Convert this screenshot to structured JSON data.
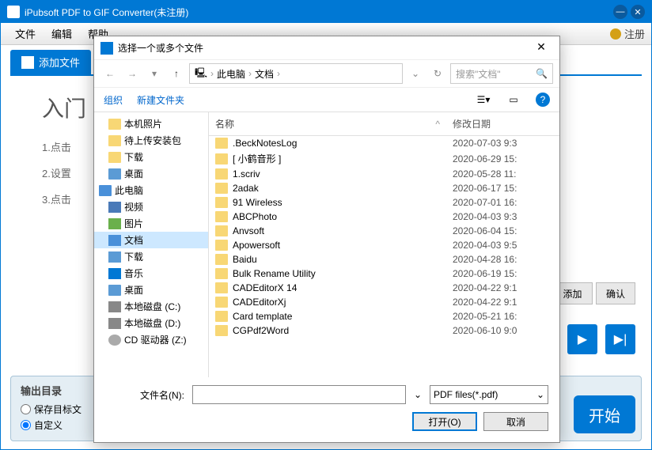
{
  "app": {
    "title": "iPubsoft PDF to GIF Converter(未注册)",
    "menus": {
      "file": "文件",
      "edit": "编辑",
      "help": "帮助",
      "register": "注册"
    },
    "add_file": "添加文件",
    "heading": "入门",
    "steps": {
      "s1": "1.点击",
      "s2": "2.设置",
      "s3": "3.点击"
    },
    "side": {
      "add": "添加",
      "confirm": "确认"
    },
    "output": {
      "title": "输出目录",
      "opt1": "保存目标文",
      "opt2": "自定义"
    },
    "start": "开始"
  },
  "dialog": {
    "title": "选择一个或多个文件",
    "breadcrumb": {
      "b1": "此电脑",
      "b2": "文档"
    },
    "search_placeholder": "搜索\"文档\"",
    "toolbar": {
      "organize": "组织",
      "new_folder": "新建文件夹"
    },
    "tree": [
      {
        "icon": "folder",
        "label": "本机照片"
      },
      {
        "icon": "folder",
        "label": "待上传安装包"
      },
      {
        "icon": "folder",
        "label": "下载"
      },
      {
        "icon": "desktop",
        "label": "桌面"
      },
      {
        "icon": "pc",
        "label": "此电脑",
        "header": true
      },
      {
        "icon": "video",
        "label": "视频"
      },
      {
        "icon": "pic",
        "label": "图片"
      },
      {
        "icon": "doc",
        "label": "文档",
        "selected": true
      },
      {
        "icon": "dl",
        "label": "下载"
      },
      {
        "icon": "music",
        "label": "音乐"
      },
      {
        "icon": "desktop",
        "label": "桌面"
      },
      {
        "icon": "drive",
        "label": "本地磁盘 (C:)"
      },
      {
        "icon": "drive",
        "label": "本地磁盘 (D:)"
      },
      {
        "icon": "cd",
        "label": "CD 驱动器 (Z:)"
      }
    ],
    "columns": {
      "name": "名称",
      "date": "修改日期"
    },
    "files": [
      {
        "name": ".BeckNotesLog",
        "date": "2020-07-03 9:3"
      },
      {
        "name": "[ 小鹤音形 ]",
        "date": "2020-06-29 15:"
      },
      {
        "name": "1.scriv",
        "date": "2020-05-28 11:"
      },
      {
        "name": "2adak",
        "date": "2020-06-17 15:"
      },
      {
        "name": "91 Wireless",
        "date": "2020-07-01 16:"
      },
      {
        "name": "ABCPhoto",
        "date": "2020-04-03 9:3"
      },
      {
        "name": "Anvsoft",
        "date": "2020-06-04 15:"
      },
      {
        "name": "Apowersoft",
        "date": "2020-04-03 9:5"
      },
      {
        "name": "Baidu",
        "date": "2020-04-28 16:"
      },
      {
        "name": "Bulk Rename Utility",
        "date": "2020-06-19 15:"
      },
      {
        "name": "CADEditorX 14",
        "date": "2020-04-22 9:1"
      },
      {
        "name": "CADEditorXj",
        "date": "2020-04-22 9:1"
      },
      {
        "name": "Card template",
        "date": "2020-05-21 16:"
      },
      {
        "name": "CGPdf2Word",
        "date": "2020-06-10 9:0"
      }
    ],
    "footer": {
      "filename_label": "文件名(N):",
      "filter": "PDF files(*.pdf)",
      "open": "打开(O)",
      "cancel": "取消"
    }
  }
}
